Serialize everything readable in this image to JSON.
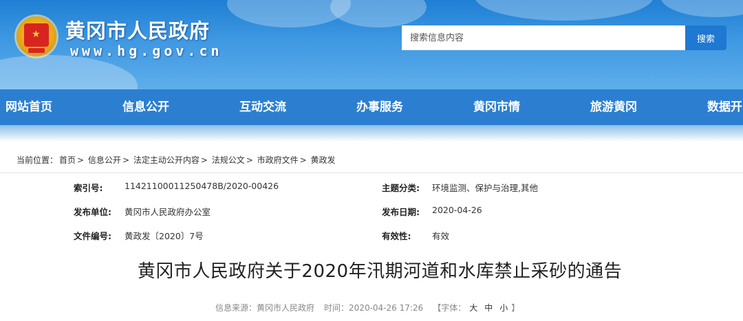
{
  "header": {
    "site_title": "黄冈市人民政府",
    "site_domain": "www.hg.gov.cn",
    "emblem": "national-emblem-icon"
  },
  "search": {
    "placeholder": "搜索信息内容",
    "button_label": "搜索"
  },
  "nav": {
    "items": [
      {
        "label": "网站首页"
      },
      {
        "label": "信息公开"
      },
      {
        "label": "互动交流"
      },
      {
        "label": "办事服务"
      },
      {
        "label": "黄冈市情"
      },
      {
        "label": "旅游黄冈"
      },
      {
        "label": "数据开"
      }
    ]
  },
  "breadcrumb": {
    "prefix": "当前位置：",
    "items": [
      "首页",
      "信息公开",
      "法定主动公开内容",
      "法规公文",
      "市政府文件",
      "黄政发"
    ],
    "separator": ">"
  },
  "info": {
    "index_label": "索引号:",
    "index_value": "11421100011250478B/2020-00426",
    "subject_label": "主题分类:",
    "subject_value": "环境监测、保护与治理,其他",
    "publisher_label": "发布单位:",
    "publisher_value": "黄冈市人民政府办公室",
    "date_label": "发布日期:",
    "date_value": "2020-04-26",
    "docno_label": "文件编号:",
    "docno_value": "黄政发〔2020〕7号",
    "validity_label": "有效性:",
    "validity_value": "有效"
  },
  "article": {
    "title": "黄冈市人民政府关于2020年汛期河道和水库禁止采砂的通告",
    "source_label": "信息来源：",
    "source_value": "黄冈市人民政府",
    "time_label": "时间：",
    "time_value": "2020-04-26 17:26",
    "font_label": "【字体：",
    "font_large": "大",
    "font_medium": "中",
    "font_small": "小",
    "font_close": "】"
  },
  "colors": {
    "header_blue": "#2a86d8",
    "nav_blue": "#2c7fd0",
    "search_button": "#1f78d1"
  }
}
